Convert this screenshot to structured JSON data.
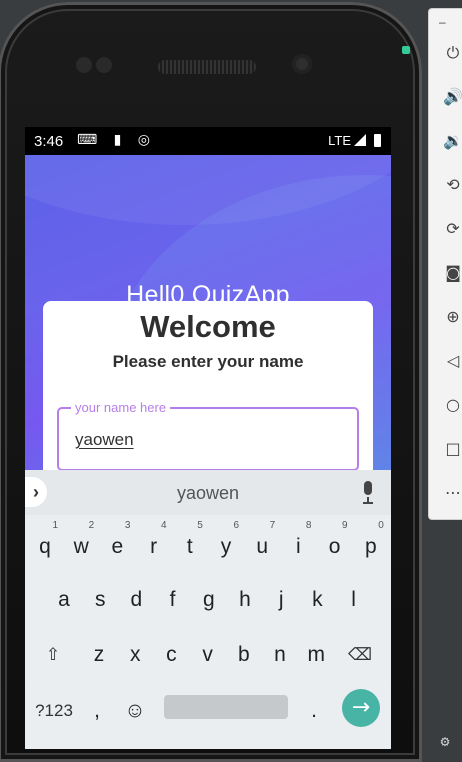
{
  "emulator_toolbar": {
    "minimize": "–",
    "buttons": [
      "power-icon",
      "volume-up-icon",
      "volume-down-icon",
      "rotate-left-icon",
      "rotate-right-icon",
      "camera-icon",
      "zoom-icon",
      "back-icon",
      "home-icon",
      "overview-icon",
      "more-icon"
    ],
    "glyphs": {
      "power": "⏻",
      "vol_up": "🔊",
      "vol_down": "🔉",
      "rot_l": "⟲",
      "rot_r": "⟳",
      "camera": "◙",
      "zoom": "⊕",
      "back": "◁",
      "home": "○",
      "overview": "□",
      "more": "⋯"
    },
    "settings_glyph": "⚙"
  },
  "status_bar": {
    "time": "3:46",
    "icons": "⌨ ▮ ◎",
    "network": "LTE"
  },
  "app": {
    "title": "Hell0 QuizApp",
    "welcome": "Welcome",
    "subtitle": "Please enter your name",
    "name_field": {
      "label": "your name here",
      "value": "yaowen"
    },
    "colors": {
      "accent": "#b67ee8",
      "hero_start": "#5b62e8",
      "hero_end": "#5a7de6",
      "enter_key": "#47b4a5"
    }
  },
  "keyboard": {
    "suggestion": "yaowen",
    "chevron": "›",
    "row1": [
      {
        "k": "q",
        "h": "1"
      },
      {
        "k": "w",
        "h": "2"
      },
      {
        "k": "e",
        "h": "3"
      },
      {
        "k": "r",
        "h": "4"
      },
      {
        "k": "t",
        "h": "5"
      },
      {
        "k": "y",
        "h": "6"
      },
      {
        "k": "u",
        "h": "7"
      },
      {
        "k": "i",
        "h": "8"
      },
      {
        "k": "o",
        "h": "9"
      },
      {
        "k": "p",
        "h": "0"
      }
    ],
    "row2": [
      "a",
      "s",
      "d",
      "f",
      "g",
      "h",
      "j",
      "k",
      "l"
    ],
    "row3": [
      "z",
      "x",
      "c",
      "v",
      "b",
      "n",
      "m"
    ],
    "shift": "⇧",
    "backspace": "⌫",
    "symbols": "?123",
    "comma": ",",
    "emoji": "☺",
    "period": ".",
    "enter": "→"
  }
}
